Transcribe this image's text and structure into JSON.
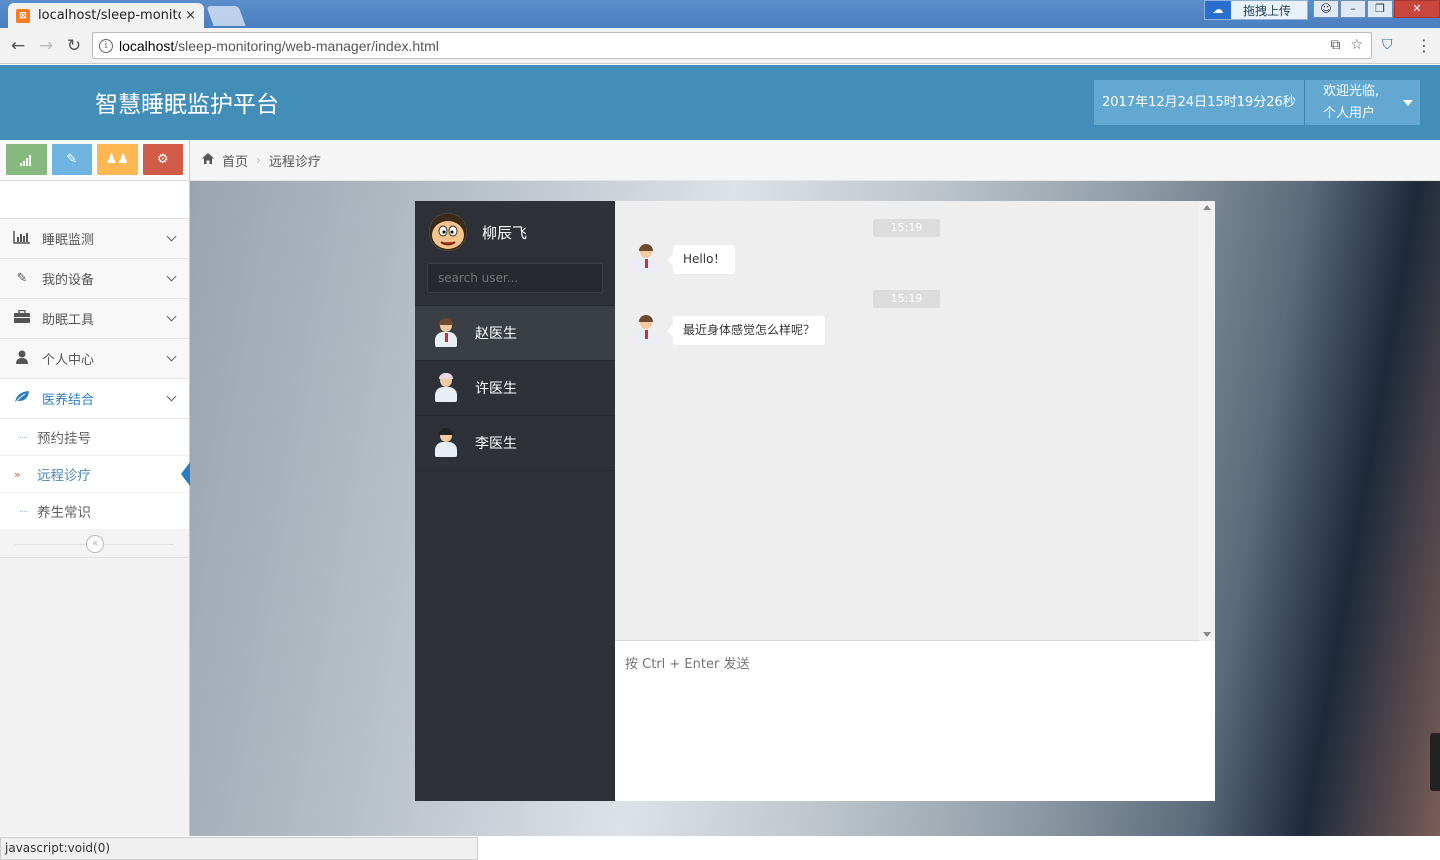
{
  "browser": {
    "tab_title": "localhost/sleep-monito",
    "tab_close": "×",
    "url_host": "localhost",
    "url_path": "/sleep-monitoring/web-manager/index.html",
    "upload_label": "拖拽上传",
    "back": "←",
    "forward": "→",
    "reload": "↻",
    "status_text": "javascript:void(0)"
  },
  "header": {
    "title": "智慧睡眠监护平台",
    "datetime": "2017年12月24日15时19分26秒",
    "welcome": "欢迎光临,",
    "user_role": "个人用户"
  },
  "sidebar": {
    "items": [
      {
        "label": "睡眠监测",
        "icon": "bar-chart-icon"
      },
      {
        "label": "我的设备",
        "icon": "pencil-icon"
      },
      {
        "label": "助眠工具",
        "icon": "briefcase-icon"
      },
      {
        "label": "个人中心",
        "icon": "user-icon"
      },
      {
        "label": "医养结合",
        "icon": "leaf-icon"
      }
    ],
    "subitems": [
      {
        "label": "预约挂号"
      },
      {
        "label": "远程诊疗"
      },
      {
        "label": "养生常识"
      }
    ]
  },
  "breadcrumb": {
    "home": "首页",
    "current": "远程诊疗"
  },
  "chat": {
    "me_name": "柳辰飞",
    "search_placeholder": "search user...",
    "contacts": [
      {
        "name": "赵医生"
      },
      {
        "name": "许医生"
      },
      {
        "name": "李医生"
      }
    ],
    "messages": [
      {
        "time": "15:19",
        "text": "Hello！"
      },
      {
        "time": "15:19",
        "text": "最近身体感觉怎么样呢？"
      }
    ],
    "compose_placeholder": "按 Ctrl + Enter 发送"
  },
  "colors": {
    "header_bg": "#438eb9",
    "chat_sidebar_bg": "#2e3238",
    "active_nav": "#2b7dbc"
  }
}
